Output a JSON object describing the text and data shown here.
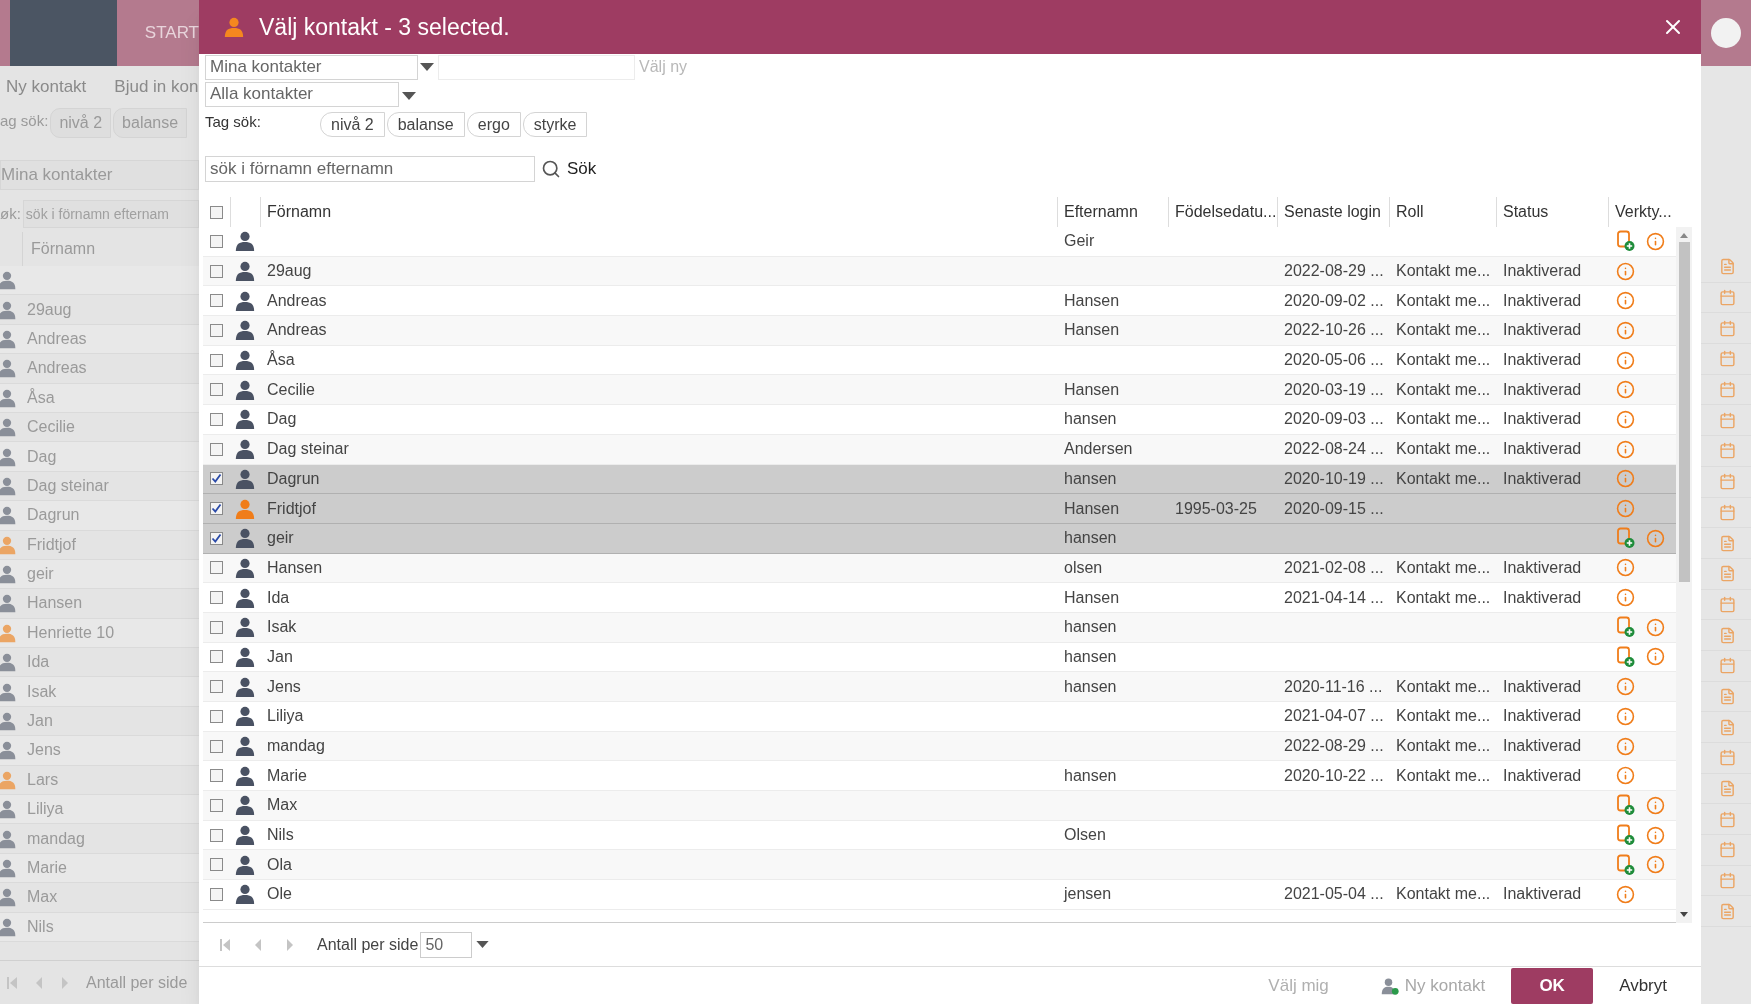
{
  "background": {
    "header_label": "START",
    "toolbar": [
      "Ny kontakt",
      "Bjud in kon"
    ],
    "tag_label": "ag sök:",
    "tags": [
      "nivå 2",
      "balanse"
    ],
    "list_select": "Mina kontakter",
    "search_label": "øk:",
    "search_placeholder": "sök i förnamn efternam",
    "column": "Förnamn",
    "rows": [
      {
        "name": "",
        "color": "#8a8f99"
      },
      {
        "name": "29aug",
        "color": "#8a8f99"
      },
      {
        "name": "Andreas",
        "color": "#8a8f99"
      },
      {
        "name": "Andreas",
        "color": "#8a8f99"
      },
      {
        "name": "Åsa",
        "color": "#8a8f99"
      },
      {
        "name": "Cecilie",
        "color": "#8a8f99"
      },
      {
        "name": "Dag",
        "color": "#8a8f99"
      },
      {
        "name": "Dag steinar",
        "color": "#8a8f99"
      },
      {
        "name": "Dagrun",
        "color": "#8a8f99"
      },
      {
        "name": "Fridtjof",
        "color": "#eba564"
      },
      {
        "name": "geir",
        "color": "#8a8f99"
      },
      {
        "name": "Hansen",
        "color": "#8a8f99"
      },
      {
        "name": "Henriette 10",
        "color": "#eba564"
      },
      {
        "name": "Ida",
        "color": "#8a8f99"
      },
      {
        "name": "Isak",
        "color": "#8a8f99"
      },
      {
        "name": "Jan",
        "color": "#8a8f99"
      },
      {
        "name": "Jens",
        "color": "#8a8f99"
      },
      {
        "name": "Lars",
        "color": "#eba564"
      },
      {
        "name": "Liliya",
        "color": "#8a8f99"
      },
      {
        "name": "mandag",
        "color": "#8a8f99"
      },
      {
        "name": "Marie",
        "color": "#8a8f99"
      },
      {
        "name": "Max",
        "color": "#8a8f99"
      },
      {
        "name": "Nils",
        "color": "#8a8f99"
      }
    ],
    "pager_label": "Antall per side"
  },
  "right_strip": {
    "icons": [
      {
        "kind": "doc"
      },
      {
        "kind": "calendar"
      },
      {
        "kind": "calendar"
      },
      {
        "kind": "calendar"
      },
      {
        "kind": "calendar"
      },
      {
        "kind": "calendar"
      },
      {
        "kind": "calendar"
      },
      {
        "kind": "calendar"
      },
      {
        "kind": "calendar"
      },
      {
        "kind": "doc"
      },
      {
        "kind": "doc"
      },
      {
        "kind": "calendar"
      },
      {
        "kind": "doc"
      },
      {
        "kind": "calendar"
      },
      {
        "kind": "doc"
      },
      {
        "kind": "doc"
      },
      {
        "kind": "calendar"
      },
      {
        "kind": "doc"
      },
      {
        "kind": "calendar"
      },
      {
        "kind": "calendar"
      },
      {
        "kind": "calendar"
      },
      {
        "kind": "doc"
      }
    ]
  },
  "dialog": {
    "title": "Välj kontakt - 3 selected.",
    "list_select": "Mina kontakter",
    "choose_new": "Välj ny",
    "filter_select": "Alla kontakter",
    "tag_label": "Tag sök:",
    "tags": [
      "nivå 2",
      "balanse",
      "ergo",
      "styrke"
    ],
    "search_placeholder": "sök i förnamn efternamn",
    "search_button": "Sök",
    "table": {
      "select_all": false,
      "columns": [
        "Förnamn",
        "Efternamn",
        "Födelsedatu...",
        "Senaste login",
        "Roll",
        "Status",
        "Verkty..."
      ],
      "rows": [
        {
          "first": "",
          "last": "Geir",
          "birth": "",
          "login": "",
          "role": "",
          "status": "",
          "selected": false,
          "color": "#4a5263",
          "add_icon": true
        },
        {
          "first": "29aug",
          "last": "",
          "birth": "",
          "login": "2022-08-29 ...",
          "role": "Kontakt me...",
          "status": "Inaktiverad",
          "selected": false,
          "color": "#4a5263",
          "add_icon": false
        },
        {
          "first": "Andreas",
          "last": "Hansen",
          "birth": "",
          "login": "2020-09-02 ...",
          "role": "Kontakt me...",
          "status": "Inaktiverad",
          "selected": false,
          "color": "#4a5263",
          "add_icon": false
        },
        {
          "first": "Andreas",
          "last": "Hansen",
          "birth": "",
          "login": "2022-10-26 ...",
          "role": "Kontakt me...",
          "status": "Inaktiverad",
          "selected": false,
          "color": "#4a5263",
          "add_icon": false
        },
        {
          "first": "Åsa",
          "last": "",
          "birth": "",
          "login": "2020-05-06 ...",
          "role": "Kontakt me...",
          "status": "Inaktiverad",
          "selected": false,
          "color": "#4a5263",
          "add_icon": false
        },
        {
          "first": "Cecilie",
          "last": "Hansen",
          "birth": "",
          "login": "2020-03-19 ...",
          "role": "Kontakt me...",
          "status": "Inaktiverad",
          "selected": false,
          "color": "#4a5263",
          "add_icon": false
        },
        {
          "first": "Dag",
          "last": "hansen",
          "birth": "",
          "login": "2020-09-03 ...",
          "role": "Kontakt me...",
          "status": "Inaktiverad",
          "selected": false,
          "color": "#4a5263",
          "add_icon": false
        },
        {
          "first": "Dag steinar",
          "last": "Andersen",
          "birth": "",
          "login": "2022-08-24 ...",
          "role": "Kontakt me...",
          "status": "Inaktiverad",
          "selected": false,
          "color": "#4a5263",
          "add_icon": false
        },
        {
          "first": "Dagrun",
          "last": "hansen",
          "birth": "",
          "login": "2020-10-19 ...",
          "role": "Kontakt me...",
          "status": "Inaktiverad",
          "selected": true,
          "color": "#4a5263",
          "add_icon": false
        },
        {
          "first": "Fridtjof",
          "last": "Hansen",
          "birth": "1995-03-25",
          "login": "2020-09-15 ...",
          "role": "",
          "status": "",
          "selected": true,
          "color": "#f07d1a",
          "add_icon": false
        },
        {
          "first": "geir",
          "last": "hansen",
          "birth": "",
          "login": "",
          "role": "",
          "status": "",
          "selected": true,
          "color": "#4a5263",
          "add_icon": true
        },
        {
          "first": "Hansen",
          "last": "olsen",
          "birth": "",
          "login": "2021-02-08 ...",
          "role": "Kontakt me...",
          "status": "Inaktiverad",
          "selected": false,
          "color": "#4a5263",
          "add_icon": false
        },
        {
          "first": "Ida",
          "last": "Hansen",
          "birth": "",
          "login": "2021-04-14 ...",
          "role": "Kontakt me...",
          "status": "Inaktiverad",
          "selected": false,
          "color": "#4a5263",
          "add_icon": false
        },
        {
          "first": "Isak",
          "last": "hansen",
          "birth": "",
          "login": "",
          "role": "",
          "status": "",
          "selected": false,
          "color": "#4a5263",
          "add_icon": true
        },
        {
          "first": "Jan",
          "last": "hansen",
          "birth": "",
          "login": "",
          "role": "",
          "status": "",
          "selected": false,
          "color": "#4a5263",
          "add_icon": true
        },
        {
          "first": "Jens",
          "last": "hansen",
          "birth": "",
          "login": "2020-11-16 ...",
          "role": "Kontakt me...",
          "status": "Inaktiverad",
          "selected": false,
          "color": "#4a5263",
          "add_icon": false
        },
        {
          "first": "Liliya",
          "last": "",
          "birth": "",
          "login": "2021-04-07 ...",
          "role": "Kontakt me...",
          "status": "Inaktiverad",
          "selected": false,
          "color": "#4a5263",
          "add_icon": false
        },
        {
          "first": "mandag",
          "last": "",
          "birth": "",
          "login": "2022-08-29 ...",
          "role": "Kontakt me...",
          "status": "Inaktiverad",
          "selected": false,
          "color": "#4a5263",
          "add_icon": false
        },
        {
          "first": "Marie",
          "last": "hansen",
          "birth": "",
          "login": "2020-10-22 ...",
          "role": "Kontakt me...",
          "status": "Inaktiverad",
          "selected": false,
          "color": "#4a5263",
          "add_icon": false
        },
        {
          "first": "Max",
          "last": "",
          "birth": "",
          "login": "",
          "role": "",
          "status": "",
          "selected": false,
          "color": "#4a5263",
          "add_icon": true
        },
        {
          "first": "Nils",
          "last": "Olsen",
          "birth": "",
          "login": "",
          "role": "",
          "status": "",
          "selected": false,
          "color": "#4a5263",
          "add_icon": true
        },
        {
          "first": "Ola",
          "last": "",
          "birth": "",
          "login": "",
          "role": "",
          "status": "",
          "selected": false,
          "color": "#4a5263",
          "add_icon": true
        },
        {
          "first": "Ole",
          "last": "jensen",
          "birth": "",
          "login": "2021-05-04 ...",
          "role": "Kontakt me...",
          "status": "Inaktiverad",
          "selected": false,
          "color": "#4a5263",
          "add_icon": false
        }
      ]
    },
    "pager_label": "Antall per side",
    "page_size": "50",
    "footer": {
      "choose_me": "Välj mig",
      "new_contact": "Ny kontakt",
      "ok": "OK",
      "cancel": "Avbryt"
    }
  }
}
